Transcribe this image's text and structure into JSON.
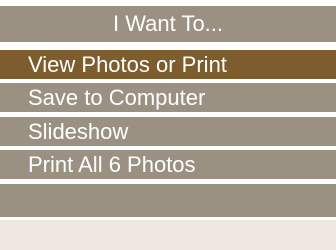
{
  "menu": {
    "title": "I Want To...",
    "items": [
      {
        "label": "View Photos or Print",
        "active": true
      },
      {
        "label": "Save to Computer",
        "active": false
      },
      {
        "label": "Slideshow",
        "active": false
      },
      {
        "label": "Print All 6 Photos",
        "active": false
      }
    ]
  },
  "colors": {
    "header_bg": "#9a9183",
    "item_bg": "#9a9183",
    "active_item_bg": "#7d5c2e",
    "text": "#ffffff",
    "footer_bg": "#efe7e0"
  }
}
